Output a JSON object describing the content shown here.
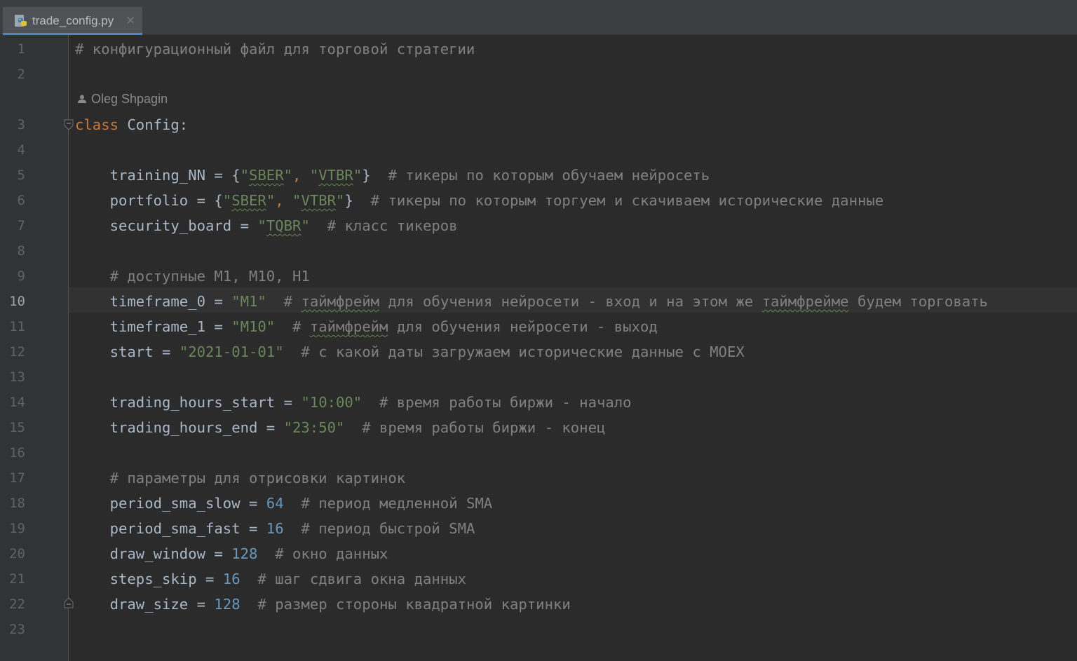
{
  "tab": {
    "filename": "trade_config.py",
    "close_glyph": "×",
    "icon": "python-file-icon"
  },
  "inlay": {
    "author": "Oleg Shpagin",
    "icon": "user-icon"
  },
  "active_line": 10,
  "lines": [
    {
      "num": "1",
      "indent": "",
      "tokens": [
        {
          "t": "# конфигурационный файл для торговой стратегии",
          "c": "cmt"
        }
      ]
    },
    {
      "num": "2",
      "indent": "",
      "tokens": []
    },
    {
      "num": "3",
      "indent": "",
      "tokens": [
        {
          "t": "class",
          "c": "kw"
        },
        {
          "t": " Config:",
          "c": ""
        }
      ]
    },
    {
      "num": "4",
      "indent": "",
      "tokens": []
    },
    {
      "num": "5",
      "indent": "    ",
      "tokens": [
        {
          "t": "training_NN = {",
          "c": ""
        },
        {
          "t": "\"",
          "c": "str"
        },
        {
          "t": "SBER",
          "c": "str sq"
        },
        {
          "t": "\"",
          "c": "str"
        },
        {
          "t": ", ",
          "c": "kw"
        },
        {
          "t": "\"",
          "c": "str"
        },
        {
          "t": "VTBR",
          "c": "str sq"
        },
        {
          "t": "\"",
          "c": "str"
        },
        {
          "t": "}  ",
          "c": ""
        },
        {
          "t": "# тикеры по которым обучаем нейросеть",
          "c": "cmt"
        }
      ]
    },
    {
      "num": "6",
      "indent": "    ",
      "tokens": [
        {
          "t": "portfolio = {",
          "c": ""
        },
        {
          "t": "\"",
          "c": "str"
        },
        {
          "t": "SBER",
          "c": "str sq"
        },
        {
          "t": "\"",
          "c": "str"
        },
        {
          "t": ", ",
          "c": "kw"
        },
        {
          "t": "\"",
          "c": "str"
        },
        {
          "t": "VTBR",
          "c": "str sq"
        },
        {
          "t": "\"",
          "c": "str"
        },
        {
          "t": "}  ",
          "c": ""
        },
        {
          "t": "# тикеры по которым торгуем и скачиваем исторические данные",
          "c": "cmt"
        }
      ]
    },
    {
      "num": "7",
      "indent": "    ",
      "tokens": [
        {
          "t": "security_board = ",
          "c": ""
        },
        {
          "t": "\"",
          "c": "str"
        },
        {
          "t": "TQBR",
          "c": "str sq"
        },
        {
          "t": "\"",
          "c": "str"
        },
        {
          "t": "  ",
          "c": ""
        },
        {
          "t": "# класс тикеров",
          "c": "cmt"
        }
      ]
    },
    {
      "num": "8",
      "indent": "",
      "tokens": []
    },
    {
      "num": "9",
      "indent": "    ",
      "tokens": [
        {
          "t": "# доступные M1, M10, H1",
          "c": "cmt"
        }
      ]
    },
    {
      "num": "10",
      "indent": "    ",
      "tokens": [
        {
          "t": "timeframe_0 = ",
          "c": ""
        },
        {
          "t": "\"M1\"",
          "c": "str"
        },
        {
          "t": "  ",
          "c": ""
        },
        {
          "t": "# ",
          "c": "cmt"
        },
        {
          "t": "таймфрейм",
          "c": "cmt sq"
        },
        {
          "t": " для обучения нейросети - вход и на этом же ",
          "c": "cmt"
        },
        {
          "t": "таймфрейме",
          "c": "cmt sq"
        },
        {
          "t": " будем торговать",
          "c": "cmt"
        }
      ]
    },
    {
      "num": "11",
      "indent": "    ",
      "tokens": [
        {
          "t": "timeframe_1 = ",
          "c": ""
        },
        {
          "t": "\"M10\"",
          "c": "str"
        },
        {
          "t": "  ",
          "c": ""
        },
        {
          "t": "# ",
          "c": "cmt"
        },
        {
          "t": "таймфрейм",
          "c": "cmt sq"
        },
        {
          "t": " для обучения нейросети - выход",
          "c": "cmt"
        }
      ]
    },
    {
      "num": "12",
      "indent": "    ",
      "tokens": [
        {
          "t": "start = ",
          "c": ""
        },
        {
          "t": "\"2021-01-01\"",
          "c": "str"
        },
        {
          "t": "  ",
          "c": ""
        },
        {
          "t": "# с какой даты загружаем исторические данные с MOEX",
          "c": "cmt"
        }
      ]
    },
    {
      "num": "13",
      "indent": "",
      "tokens": []
    },
    {
      "num": "14",
      "indent": "    ",
      "tokens": [
        {
          "t": "trading_hours_start = ",
          "c": ""
        },
        {
          "t": "\"10:00\"",
          "c": "str"
        },
        {
          "t": "  ",
          "c": ""
        },
        {
          "t": "# время работы биржи - начало",
          "c": "cmt"
        }
      ]
    },
    {
      "num": "15",
      "indent": "    ",
      "tokens": [
        {
          "t": "trading_hours_end = ",
          "c": ""
        },
        {
          "t": "\"23:50\"",
          "c": "str"
        },
        {
          "t": "  ",
          "c": ""
        },
        {
          "t": "# время работы биржи - конец",
          "c": "cmt"
        }
      ]
    },
    {
      "num": "16",
      "indent": "",
      "tokens": []
    },
    {
      "num": "17",
      "indent": "    ",
      "tokens": [
        {
          "t": "# параметры для отрисовки картинок",
          "c": "cmt"
        }
      ]
    },
    {
      "num": "18",
      "indent": "    ",
      "tokens": [
        {
          "t": "period_sma_slow = ",
          "c": ""
        },
        {
          "t": "64",
          "c": "num"
        },
        {
          "t": "  ",
          "c": ""
        },
        {
          "t": "# период медленной SMA",
          "c": "cmt"
        }
      ]
    },
    {
      "num": "19",
      "indent": "    ",
      "tokens": [
        {
          "t": "period_sma_fast = ",
          "c": ""
        },
        {
          "t": "16",
          "c": "num"
        },
        {
          "t": "  ",
          "c": ""
        },
        {
          "t": "# период быстрой SMA",
          "c": "cmt"
        }
      ]
    },
    {
      "num": "20",
      "indent": "    ",
      "tokens": [
        {
          "t": "draw_window = ",
          "c": ""
        },
        {
          "t": "128",
          "c": "num"
        },
        {
          "t": "  ",
          "c": ""
        },
        {
          "t": "# окно данных",
          "c": "cmt"
        }
      ]
    },
    {
      "num": "21",
      "indent": "    ",
      "tokens": [
        {
          "t": "steps_skip = ",
          "c": ""
        },
        {
          "t": "16",
          "c": "num"
        },
        {
          "t": "  ",
          "c": ""
        },
        {
          "t": "# шаг сдвига окна данных",
          "c": "cmt"
        }
      ]
    },
    {
      "num": "22",
      "indent": "    ",
      "tokens": [
        {
          "t": "draw_size = ",
          "c": ""
        },
        {
          "t": "128",
          "c": "num"
        },
        {
          "t": "  ",
          "c": ""
        },
        {
          "t": "# размер стороны квадратной картинки",
          "c": "cmt"
        }
      ]
    },
    {
      "num": "23",
      "indent": "",
      "tokens": []
    }
  ]
}
